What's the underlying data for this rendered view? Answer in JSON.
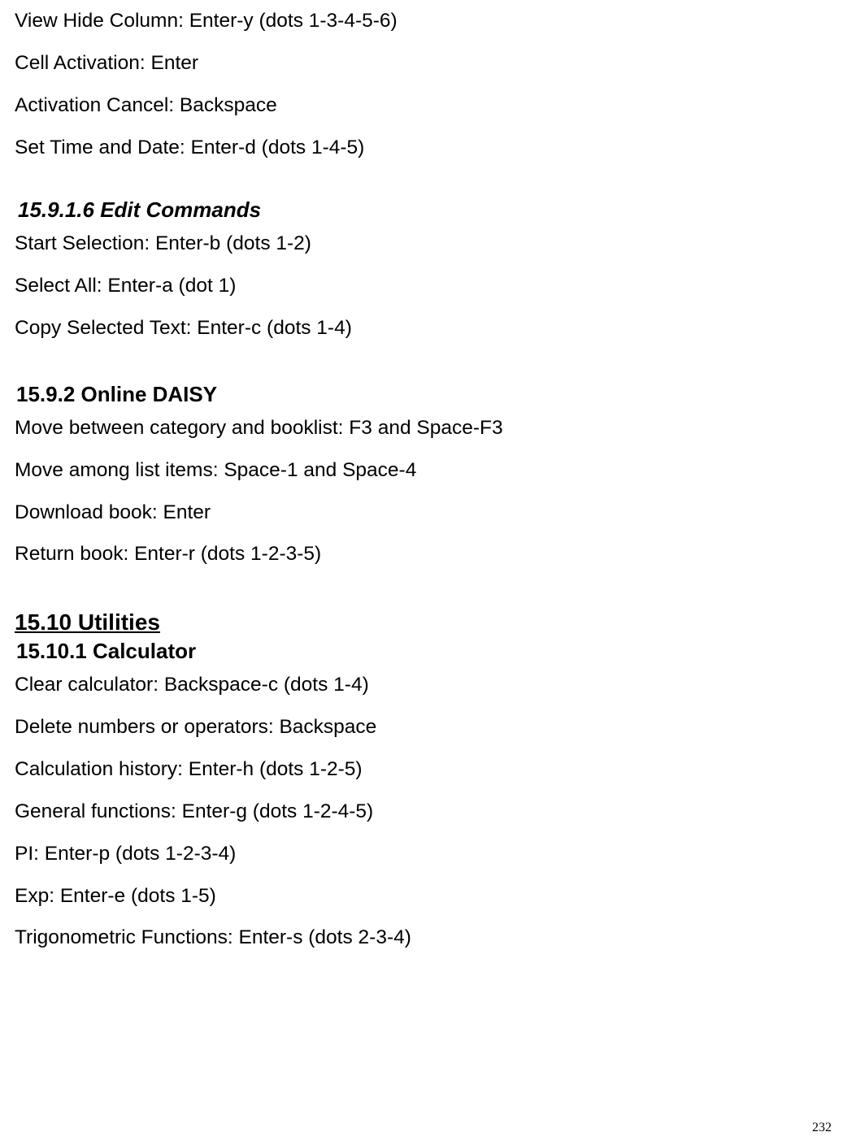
{
  "lines": {
    "l1": "View Hide Column: Enter-y (dots 1-3-4-5-6)",
    "l2": "Cell Activation: Enter",
    "l3": "Activation Cancel: Backspace",
    "l4": "Set Time and Date: Enter-d (dots 1-4-5)"
  },
  "section_edit": {
    "heading": "15.9.1.6 Edit Commands",
    "l1": "Start Selection: Enter-b (dots 1-2)",
    "l2": "Select All: Enter-a (dot 1)",
    "l3": "Copy Selected Text: Enter-c (dots 1-4)"
  },
  "section_daisy": {
    "heading": "15.9.2 Online DAISY",
    "l1": "Move between category and booklist: F3 and Space-F3",
    "l2": "Move among list items: Space-1 and Space-4",
    "l3": "Download book: Enter",
    "l4": "Return book: Enter-r (dots 1-2-3-5)"
  },
  "section_utilities": {
    "heading": "15.10 Utilities",
    "sub_heading": "15.10.1 Calculator",
    "l1": "Clear calculator: Backspace-c (dots 1-4)",
    "l2": "Delete numbers or operators: Backspace",
    "l3": "Calculation history: Enter-h (dots 1-2-5)",
    "l4": "General functions: Enter-g (dots 1-2-4-5)",
    "l5": "PI: Enter-p (dots 1-2-3-4)",
    "l6": "Exp: Enter-e (dots 1-5)",
    "l7": "Trigonometric Functions: Enter-s (dots 2-3-4)"
  },
  "page_number": "232"
}
